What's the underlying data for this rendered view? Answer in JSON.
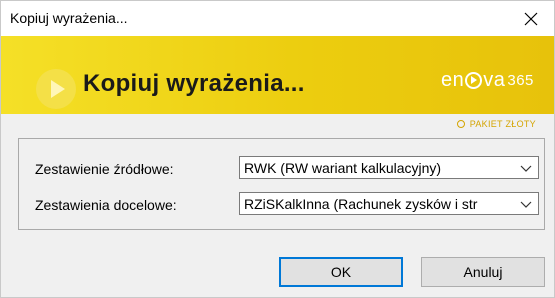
{
  "window": {
    "title": "Kopiuj wyrażenia..."
  },
  "banner": {
    "title": "Kopiuj wyrażenia...",
    "logo_text_1": "en",
    "logo_text_2": "va",
    "logo_number": "365",
    "package_label": "PAKIET ZŁOTY"
  },
  "form": {
    "source_label": "Zestawienie źródłowe:",
    "source_value": "RWK (RW wariant kalkulacyjny)",
    "target_label": "Zestawienia docelowe:",
    "target_value": "RZiSKalkInna (Rachunek zysków i str"
  },
  "buttons": {
    "ok_label": "OK",
    "cancel_label": "Anuluj"
  },
  "colors": {
    "banner": "#eccd0f",
    "accent": "#0078d7"
  }
}
